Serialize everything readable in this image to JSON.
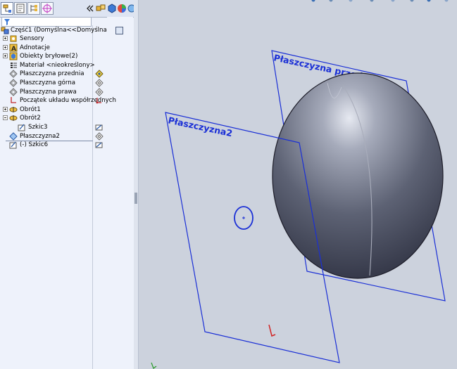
{
  "feature_tree": {
    "tabs": [
      "feature-manager",
      "property-manager",
      "configuration-manager",
      "dimxpert-manager"
    ],
    "filter_placeholder": "",
    "root": {
      "label": "Część1  (Domyślna<<Domyślna"
    },
    "items": [
      {
        "label": "Sensory",
        "icon": "sensors-icon",
        "expander": "plus"
      },
      {
        "label": "Adnotacje",
        "icon": "annotations-icon",
        "expander": "plus"
      },
      {
        "label": "Obiekty bryłowe(2)",
        "icon": "solid-bodies-icon",
        "expander": "plus"
      },
      {
        "label": "Materiał <nieokreślony>",
        "icon": "material-icon",
        "expander": "none"
      },
      {
        "label": "Płaszczyzna przednia",
        "icon": "plane-icon",
        "expander": "none",
        "status_icon": "visibility-icon"
      },
      {
        "label": "Płaszczyzna górna",
        "icon": "plane-icon",
        "expander": "none",
        "status_icon": "plane-outline-icon"
      },
      {
        "label": "Płaszczyzna prawa",
        "icon": "plane-icon",
        "expander": "none",
        "status_icon": "plane-outline-icon"
      },
      {
        "label": "Początek układu współrzędnych",
        "icon": "origin-icon",
        "expander": "none",
        "status_icon": "origin-icon"
      },
      {
        "label": "Obrót1",
        "icon": "revolve-icon",
        "expander": "plus"
      },
      {
        "label": "Obrót2",
        "icon": "revolve-icon",
        "expander": "minus"
      },
      {
        "label": "Szkic3",
        "icon": "sketch-icon",
        "expander": "none",
        "status_icon": "sketch-icon"
      },
      {
        "label": "Płaszczyzna2",
        "icon": "plane-selected-icon",
        "expander": "none",
        "status_icon": "plane-outline-icon"
      },
      {
        "label": "(-) Szkic6",
        "icon": "sketch-icon",
        "expander": "none",
        "status_icon": "sketch-icon"
      }
    ]
  },
  "viewport": {
    "plane_labels": {
      "front": "Płaszczyzna przednia",
      "plane2": "Płaszczyzna2"
    }
  },
  "colors": {
    "plane_outline": "#1a2fd6",
    "background": "#ccd2dd",
    "panel": "#eef2fb"
  }
}
